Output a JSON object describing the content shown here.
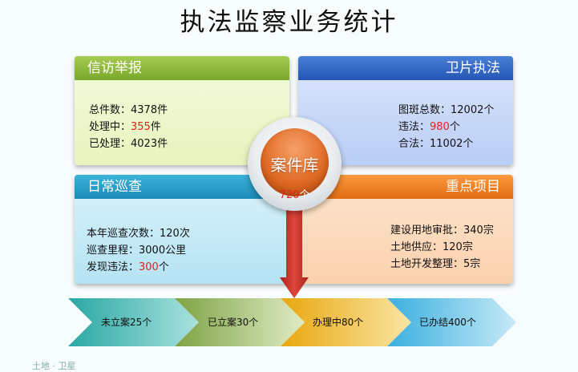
{
  "title": "执法监察业务统计",
  "panels": {
    "xinfang": {
      "header": "信访举报",
      "rows": [
        {
          "label": "总件数：",
          "value": "4378",
          "unit": "件"
        },
        {
          "label": "处理中：",
          "value": "355",
          "unit": "件"
        },
        {
          "label": "已处理：",
          "value": "4023",
          "unit": "件"
        }
      ]
    },
    "weipian": {
      "header": "卫片执法",
      "rows": [
        {
          "label": "图斑总数：",
          "value": "12002",
          "unit": "个"
        },
        {
          "label": "违法：",
          "value": "980",
          "unit": "个"
        },
        {
          "label": "合法：",
          "value": "11002",
          "unit": "个"
        }
      ]
    },
    "xuncha": {
      "header": "日常巡查",
      "rows": [
        {
          "label": "本年巡查次数：",
          "value": "120",
          "unit": "次"
        },
        {
          "label": "巡查里程：",
          "value": "3000",
          "unit": "公里"
        },
        {
          "label": "发现违法：",
          "value": "300",
          "unit": "个"
        }
      ]
    },
    "zhongdian": {
      "header": "重点项目",
      "rows": [
        {
          "label": "建设用地审批：",
          "value": "340",
          "unit": "宗"
        },
        {
          "label": "土地供应：",
          "value": "120",
          "unit": "宗"
        },
        {
          "label": "土地开发整理：",
          "value": "5",
          "unit": "宗"
        }
      ]
    }
  },
  "hub": {
    "title": "案件库",
    "count": "720",
    "unit": "个"
  },
  "process": [
    {
      "label": "未立案25个"
    },
    {
      "label": "已立案30个"
    },
    {
      "label": "办理中80个"
    },
    {
      "label": "已办结400个"
    }
  ],
  "footer": "土地 · 卫星"
}
